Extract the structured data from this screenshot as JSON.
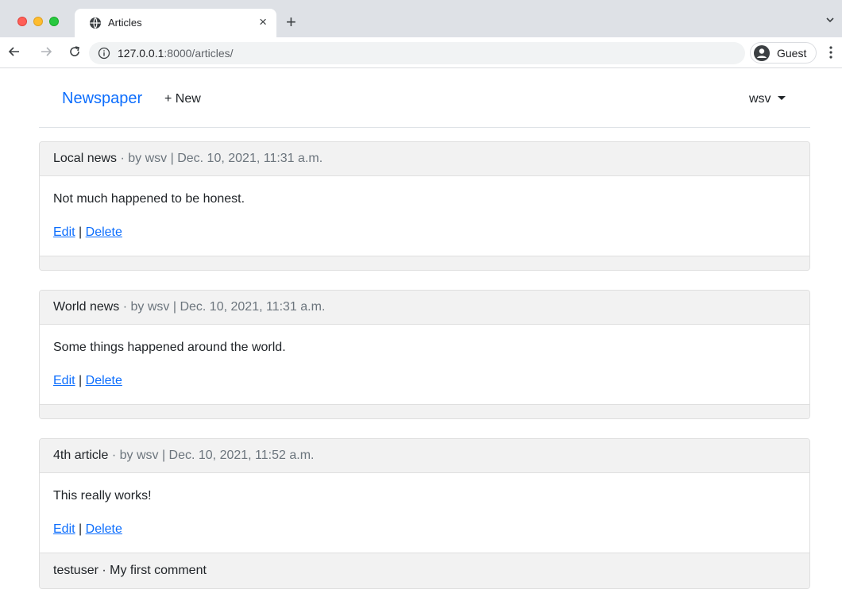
{
  "browser": {
    "tab_title": "Articles",
    "tab_close": "×",
    "new_tab": "+",
    "url_host": "127.0.0.1",
    "url_rest": ":8000/articles/",
    "profile_label": "Guest"
  },
  "navbar": {
    "brand": "Newspaper",
    "new_link": "+ New",
    "user": "wsv"
  },
  "articles": [
    {
      "title": "Local news",
      "meta": " · by wsv | Dec. 10, 2021, 11:31 a.m.",
      "body": "Not much happened to be honest.",
      "edit": "Edit",
      "separator": "|",
      "delete": "Delete",
      "comments": []
    },
    {
      "title": "World news",
      "meta": " · by wsv | Dec. 10, 2021, 11:31 a.m.",
      "body": "Some things happened around the world.",
      "edit": "Edit",
      "separator": "|",
      "delete": "Delete",
      "comments": []
    },
    {
      "title": "4th article",
      "meta": " · by wsv | Dec. 10, 2021, 11:52 a.m.",
      "body": "This really works!",
      "edit": "Edit",
      "separator": "|",
      "delete": "Delete",
      "comments": [
        "testuser · My first comment"
      ]
    }
  ],
  "colors": {
    "link": "#0d6efd",
    "card_header_bg": "#f2f2f2",
    "tabstrip_bg": "#dee1e6"
  }
}
